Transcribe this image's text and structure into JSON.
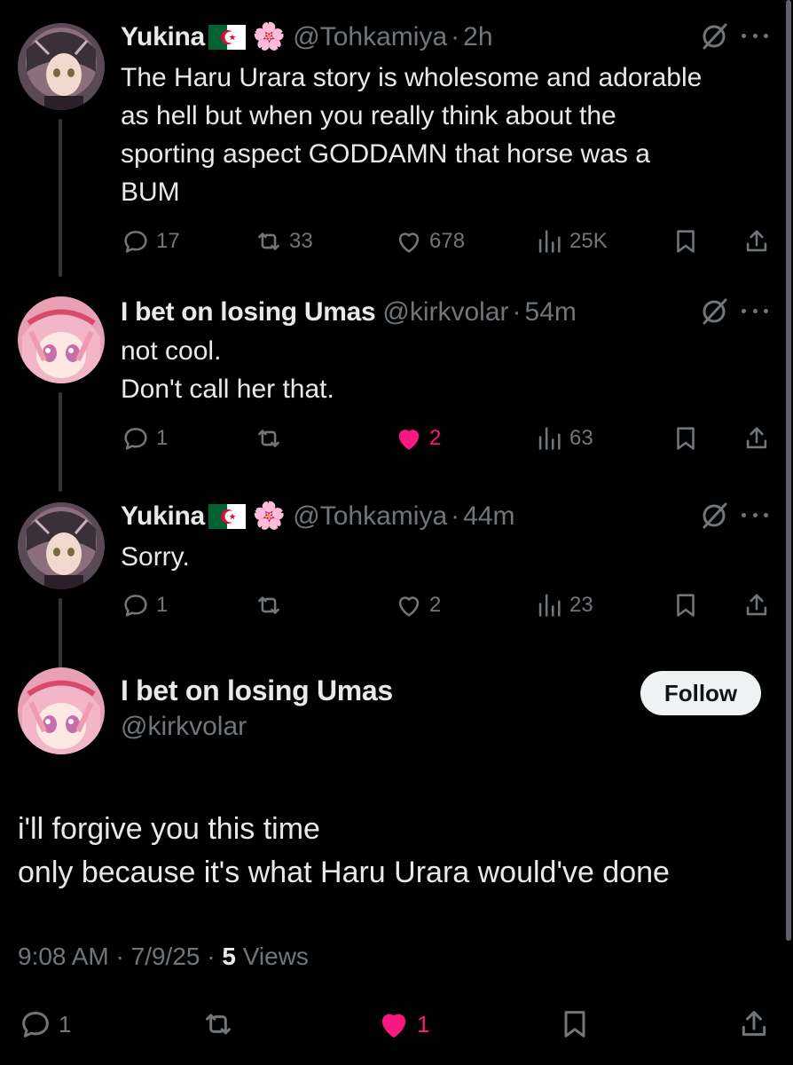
{
  "thread": [
    {
      "name": "Yukina",
      "handle": "@Tohkamiya",
      "separator": "·",
      "time": "2h",
      "emoji": "🌸",
      "lines": [
        "The Haru Urara story is wholesome and adorable",
        "as hell but when you really think about the",
        "sporting aspect GODDAMN that horse was a",
        "BUM"
      ],
      "replies": "17",
      "reposts": "33",
      "likes": "678",
      "views": "25K",
      "liked": false
    },
    {
      "name": "I bet on losing Umas",
      "handle": "@kirkvolar",
      "separator": "·",
      "time": "54m",
      "lines": [
        "not cool.",
        "Don't call her that."
      ],
      "replies": "1",
      "reposts": "",
      "likes": "2",
      "views": "63",
      "liked": true
    },
    {
      "name": "Yukina",
      "handle": "@Tohkamiya",
      "separator": "·",
      "time": "44m",
      "emoji": "🌸",
      "lines": [
        "Sorry."
      ],
      "replies": "1",
      "reposts": "",
      "likes": "2",
      "views": "23",
      "liked": false
    }
  ],
  "main": {
    "name": "I bet on losing Umas",
    "handle": "@kirkvolar",
    "follow_label": "Follow",
    "lines": [
      "i'll forgive you this time",
      "only because it's what Haru Urara would've done"
    ],
    "meta_time": "9:08 AM",
    "meta_sep1": "·",
    "meta_date": "7/9/25",
    "meta_sep2": "·",
    "meta_views_count": "5",
    "meta_views_label": "Views",
    "replies": "1",
    "likes": "1"
  },
  "colors": {
    "background": "#000000",
    "text": "#e7e9ea",
    "muted": "#71767b",
    "like": "#f91880",
    "follow_bg": "#eff3f4"
  },
  "icons": [
    "grok-icon",
    "more-icon",
    "reply-icon",
    "repost-icon",
    "like-icon",
    "views-icon",
    "bookmark-icon",
    "share-icon",
    "flag-icon"
  ]
}
